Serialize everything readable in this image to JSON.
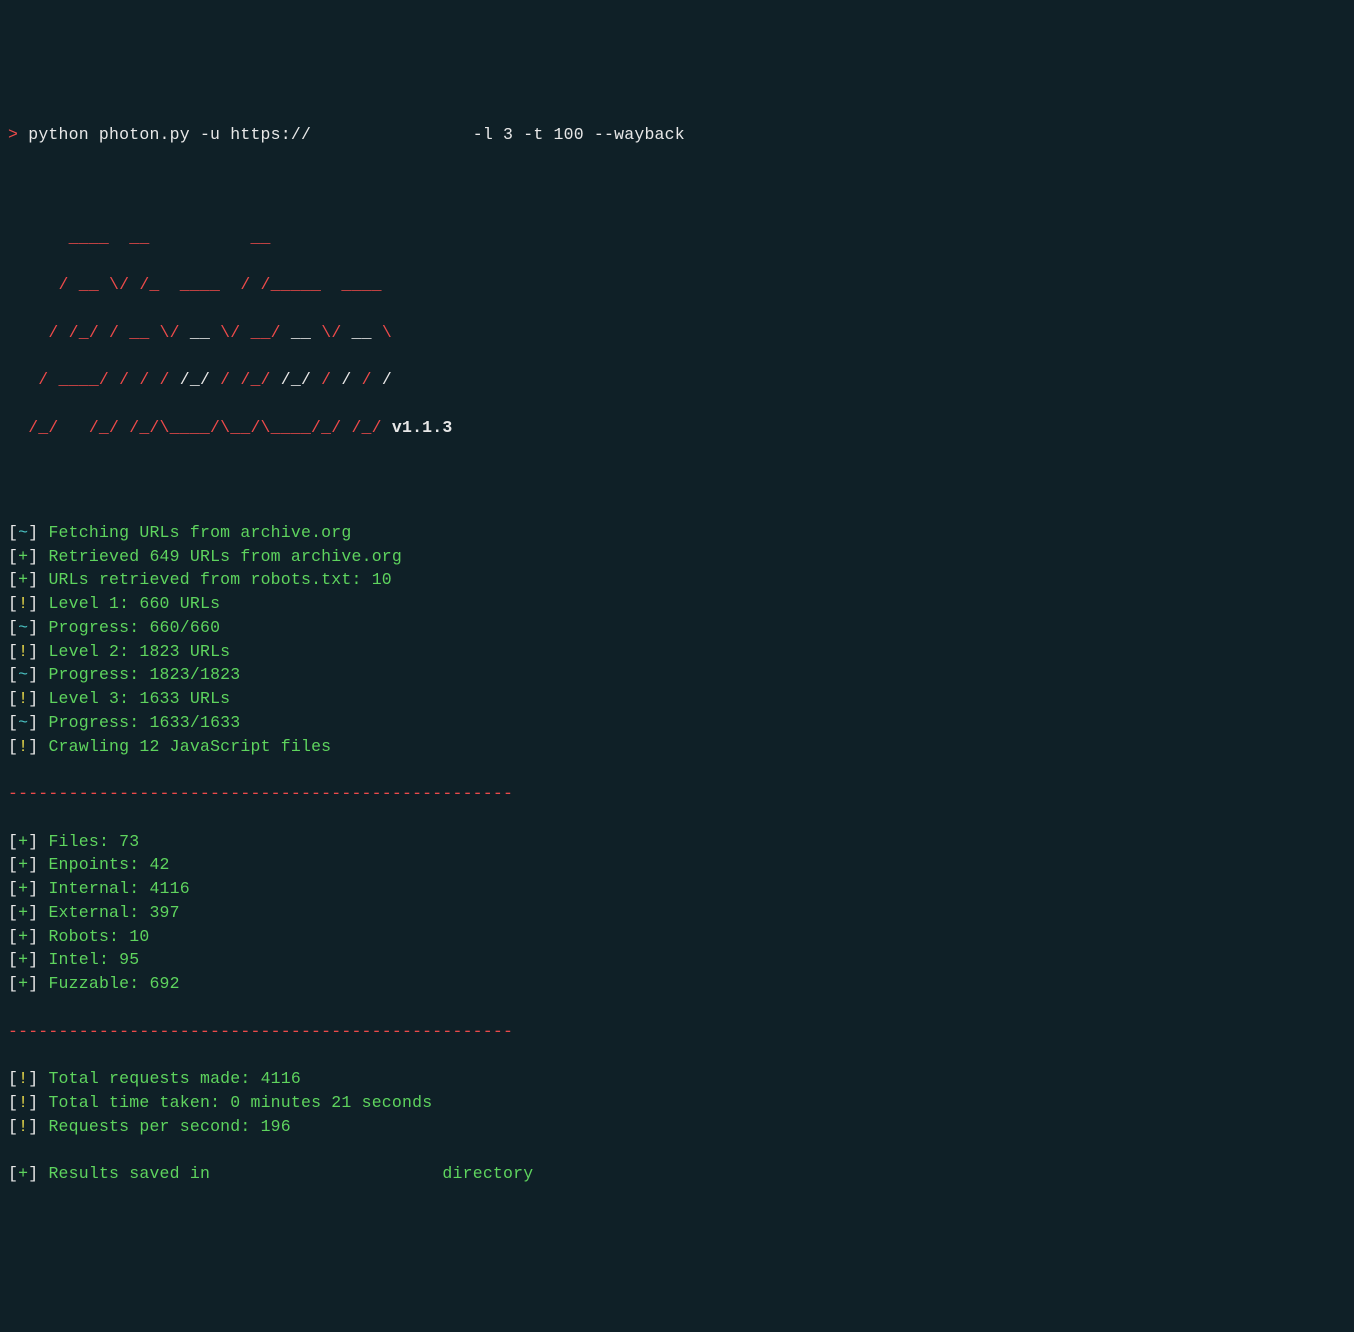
{
  "prompt": {
    "symbol": ">",
    "command_pre": "python photon.py -u https://",
    "redacted": "               ",
    "command_post": " -l 3 -t 100 --wayback"
  },
  "ascii_logo": {
    "l1a": "      ____  __          __",
    "l2a": "     / __ \\/ /_  ____  / /_____  ____",
    "l3a": "    / /_/ / __ \\/ ",
    "l3b": "__",
    "l3c": " \\/ __/ ",
    "l3d": "__",
    "l3e": " \\/ ",
    "l3f": "__",
    "l3g": " \\",
    "l4a": "   / ____/ / / / ",
    "l4b": "/_/",
    "l4c": " / /_/ ",
    "l4d": "/_/",
    "l4e": " / ",
    "l4f": "/",
    "l4g": " / ",
    "l4h": "/",
    "l5a": "  /_/   /_/ /_/\\____/\\__/\\____/_/ /_/",
    "version": " v1.1.3"
  },
  "log": [
    {
      "sym": "~",
      "msg": "Fetching URLs from archive.org"
    },
    {
      "sym": "+",
      "msg": "Retrieved 649 URLs from archive.org"
    },
    {
      "sym": "+",
      "msg": "URLs retrieved from robots.txt: 10"
    },
    {
      "sym": "!",
      "msg": "Level 1: 660 URLs"
    },
    {
      "sym": "~",
      "msg": "Progress: 660/660"
    },
    {
      "sym": "!",
      "msg": "Level 2: 1823 URLs"
    },
    {
      "sym": "~",
      "msg": "Progress: 1823/1823"
    },
    {
      "sym": "!",
      "msg": "Level 3: 1633 URLs"
    },
    {
      "sym": "~",
      "msg": "Progress: 1633/1633"
    },
    {
      "sym": "!",
      "msg": "Crawling 12 JavaScript files"
    }
  ],
  "divider": "--------------------------------------------------",
  "stats": [
    {
      "sym": "+",
      "msg": "Files: 73"
    },
    {
      "sym": "+",
      "msg": "Enpoints: 42"
    },
    {
      "sym": "+",
      "msg": "Internal: 4116"
    },
    {
      "sym": "+",
      "msg": "External: 397"
    },
    {
      "sym": "+",
      "msg": "Robots: 10"
    },
    {
      "sym": "+",
      "msg": "Intel: 95"
    },
    {
      "sym": "+",
      "msg": "Fuzzable: 692"
    }
  ],
  "summary": [
    {
      "sym": "!",
      "msg": "Total requests made: 4116"
    },
    {
      "sym": "!",
      "msg": "Total time taken: 0 minutes 21 seconds"
    },
    {
      "sym": "!",
      "msg": "Requests per second: 196"
    }
  ],
  "final": {
    "sym": "+",
    "msg_pre": "Results saved in ",
    "redacted": "                     ",
    "msg_post": " directory"
  },
  "brackets": {
    "open": "[",
    "close": "]"
  }
}
